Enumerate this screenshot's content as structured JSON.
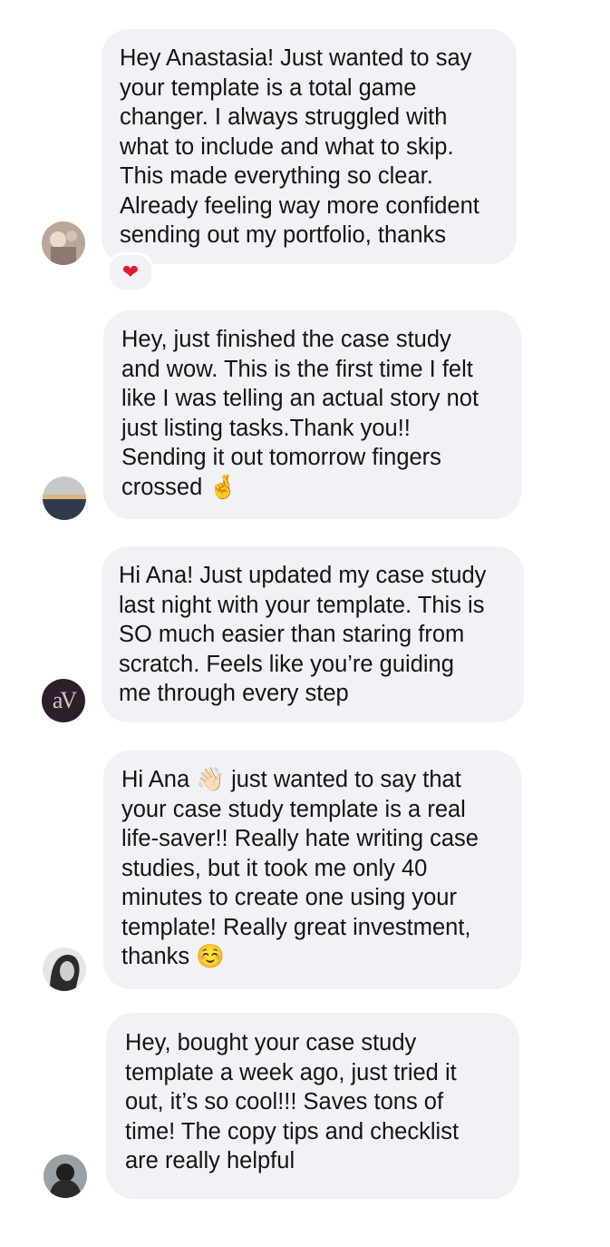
{
  "messages": [
    {
      "avatar": "photo-avatar-1",
      "text": "Hey Anastasia! Just wanted to say\nyour template is a total game\nchanger. I always struggled with\nwhat to include and what to skip.\nThis made everything so clear.\nAlready feeling way more confident\nsending out my portfolio, thanks",
      "reaction": "❤"
    },
    {
      "avatar": "photo-avatar-2",
      "text": "Hey, just finished the case study\nand wow. This is the first time I felt\nlike I was telling an actual story not\njust listing tasks.Thank you!!\nSending it out tomorrow fingers\ncrossed ",
      "emoji": "🤞"
    },
    {
      "avatar": "av-logo-avatar",
      "avatar_text": "aV",
      "text": "Hi Ana! Just updated my case study\nlast night with your template. This is\nSO much easier than staring from\nscratch. Feels like you’re guiding\nme through every step"
    },
    {
      "avatar": "photo-avatar-3",
      "text_before": "Hi Ana ",
      "emoji_wave": "👋🏻",
      "text": " just wanted to say that\nyour case study template is a real\nlife-saver!! Really hate writing case\nstudies, but it took me only 40\nminutes to create one using your\ntemplate! Really great investment,\nthanks ",
      "emoji": "☺️"
    },
    {
      "avatar": "photo-avatar-4",
      "text": "Hey, bought your case study\ntemplate a week ago, just tried it\nout, it’s so cool!!! Saves tons of\ntime! The copy tips and checklist\nare really helpful"
    }
  ],
  "colors": {
    "bubble": "#f1f2f5",
    "text": "#141414",
    "heart": "#e41a2b"
  }
}
